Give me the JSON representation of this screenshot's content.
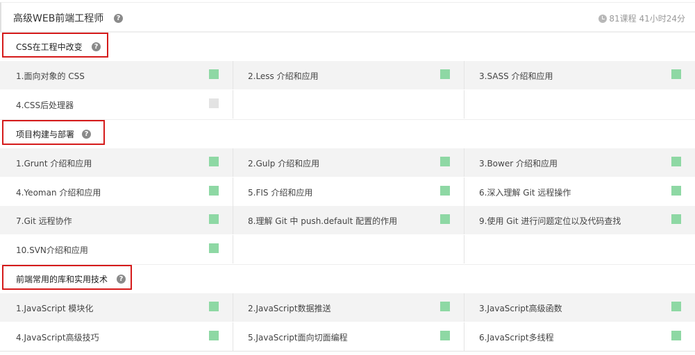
{
  "header": {
    "title": "高级WEB前端工程师",
    "help_glyph": "?",
    "stats": "81课程 41小时24分"
  },
  "colors": {
    "done": "#8ed8a4",
    "pending": "#e3e3e3",
    "highlight_border": "#d51a1a"
  },
  "sections": [
    {
      "title": "CSS在工程中改变",
      "lessons": [
        {
          "label": "1.面向对象的 CSS",
          "status": "done"
        },
        {
          "label": "2.Less 介绍和应用",
          "status": "done"
        },
        {
          "label": "3.SASS 介绍和应用",
          "status": "done"
        },
        {
          "label": "4.CSS后处理器",
          "status": "pending"
        }
      ]
    },
    {
      "title": "项目构建与部署",
      "lessons": [
        {
          "label": "1.Grunt 介绍和应用",
          "status": "done"
        },
        {
          "label": "2.Gulp 介绍和应用",
          "status": "done"
        },
        {
          "label": "3.Bower 介绍和应用",
          "status": "done"
        },
        {
          "label": "4.Yeoman 介绍和应用",
          "status": "done"
        },
        {
          "label": "5.FIS 介绍和应用",
          "status": "done"
        },
        {
          "label": "6.深入理解 Git 远程操作",
          "status": "done"
        },
        {
          "label": "7.Git 远程协作",
          "status": "done"
        },
        {
          "label": "8.理解 Git 中 push.default 配置的作用",
          "status": "done"
        },
        {
          "label": "9.使用 Git 进行问题定位以及代码查找",
          "status": "done"
        },
        {
          "label": "10.SVN介绍和应用",
          "status": "done"
        }
      ]
    },
    {
      "title": "前端常用的库和实用技术",
      "lessons": [
        {
          "label": "1.JavaScript 模块化",
          "status": "done"
        },
        {
          "label": "2.JavaScript数据推送",
          "status": "done"
        },
        {
          "label": "3.JavaScript高级函数",
          "status": "done"
        },
        {
          "label": "4.JavaScript高级技巧",
          "status": "done"
        },
        {
          "label": "5.JavaScript面向切面编程",
          "status": "done"
        },
        {
          "label": "6.JavaScript多线程",
          "status": "done"
        }
      ]
    }
  ]
}
